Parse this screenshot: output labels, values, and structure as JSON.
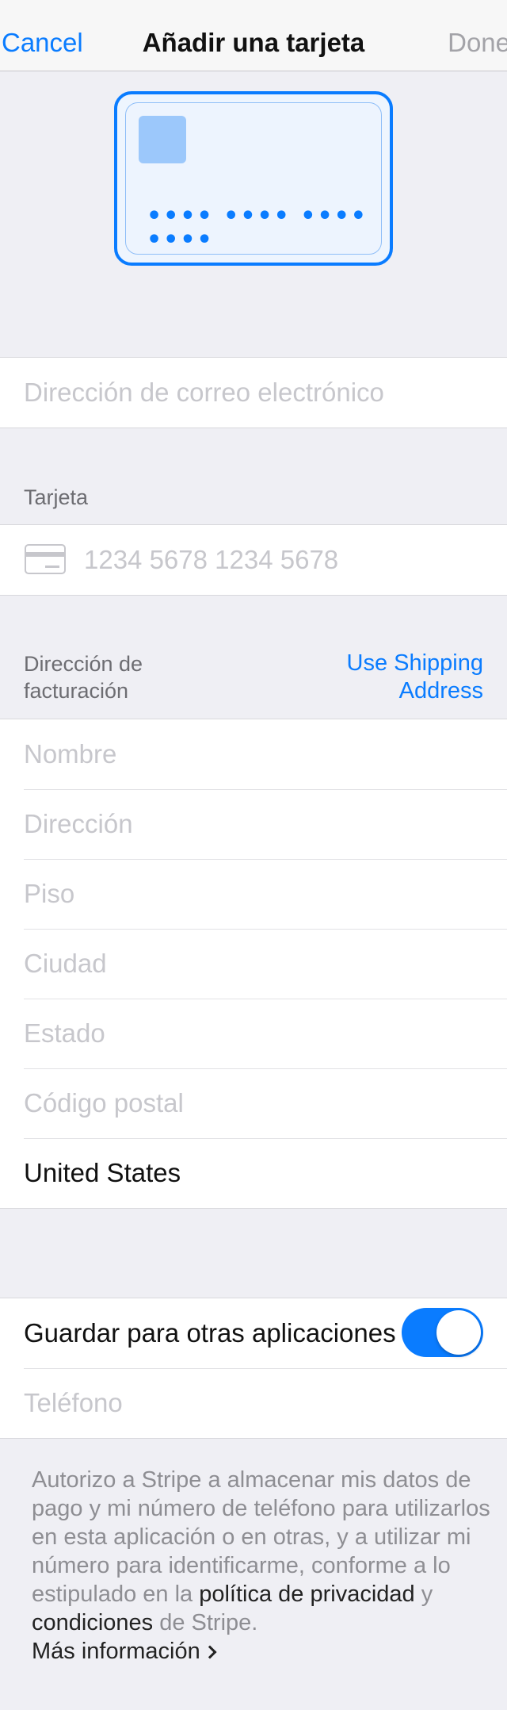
{
  "nav": {
    "cancel_label": "Cancel",
    "title": "Añadir una tarjeta",
    "done_label": "Done"
  },
  "card_preview": {
    "number_mask": "•••• •••• •••• ••••"
  },
  "email": {
    "placeholder": "Dirección de correo electrónico"
  },
  "card_section": {
    "label": "Tarjeta",
    "number_placeholder": "1234 5678 1234 5678"
  },
  "billing": {
    "label_line1": "Dirección de",
    "label_line2": "facturación",
    "use_shipping_line1": "Use Shipping",
    "use_shipping_line2": "Address",
    "fields": {
      "name": "Nombre",
      "address": "Dirección",
      "floor": "Piso",
      "city": "Ciudad",
      "state": "Estado",
      "postal": "Código postal",
      "country": "United States"
    }
  },
  "save": {
    "label": "Guardar para otras aplicaciones",
    "toggle_on": true,
    "phone_placeholder": "Teléfono"
  },
  "legal": {
    "text_start": "Autorizo a Stripe a almacenar mis datos de pago y mi número de teléfono para utilizarlos en esta aplicación o en otras, y a utilizar mi número para identificarme, conforme a lo estipulado en la",
    "privacy_link": "política de privacidad",
    "conjunction": "y",
    "terms_link": "condiciones",
    "suffix": "de Stripe.",
    "more_info": "Más información"
  },
  "colors": {
    "accent": "#0a7cff",
    "background": "#efeff4",
    "placeholder": "#c7c7cc"
  }
}
